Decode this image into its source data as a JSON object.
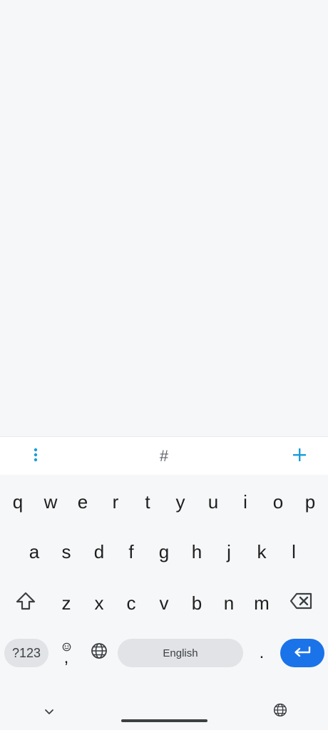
{
  "toolbar": {
    "menu_icon": "more-vert-icon",
    "hash_label": "#",
    "add_icon": "plus-icon",
    "accent_color": "#1a9ddb"
  },
  "keyboard": {
    "row1": [
      "q",
      "w",
      "e",
      "r",
      "t",
      "y",
      "u",
      "i",
      "o",
      "p"
    ],
    "row2": [
      "a",
      "s",
      "d",
      "f",
      "g",
      "h",
      "j",
      "k",
      "l"
    ],
    "row3": [
      "z",
      "x",
      "c",
      "v",
      "b",
      "n",
      "m"
    ],
    "symbols_label": "?123",
    "comma_label": ",",
    "space_label": "English",
    "period_label": ".",
    "enter_color": "#1a73e8"
  },
  "navbar": {
    "hide_keyboard_icon": "chevron-down-icon",
    "language_icon": "globe-icon"
  }
}
